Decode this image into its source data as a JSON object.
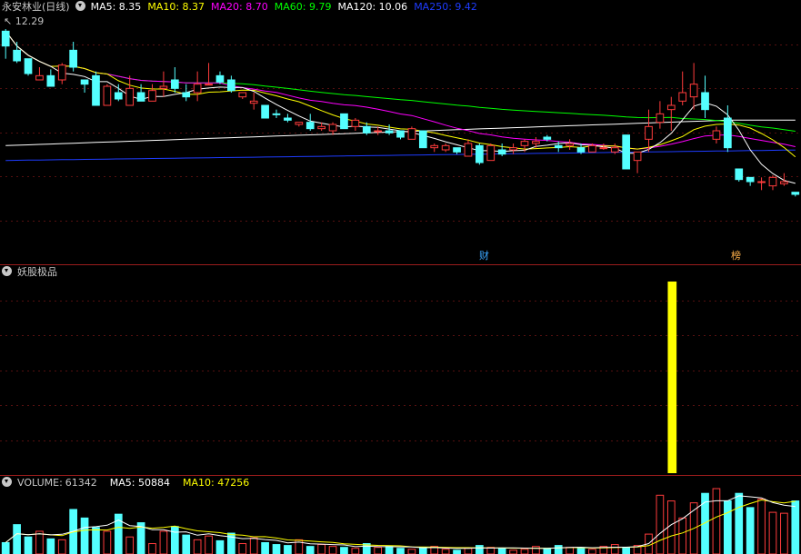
{
  "main": {
    "name": "永安林业(日线)",
    "ma": [
      {
        "label": "MA5:",
        "value": "8.35",
        "color": "#ffffff"
      },
      {
        "label": "MA10:",
        "value": "8.37",
        "color": "#ffff00"
      },
      {
        "label": "MA20:",
        "value": "8.70",
        "color": "#ff00ff"
      },
      {
        "label": "MA60:",
        "value": "9.79",
        "color": "#00ff00"
      },
      {
        "label": "MA120:",
        "value": "10.06",
        "color": "#ffffff"
      },
      {
        "label": "MA250:",
        "value": "9.42",
        "color": "#1e3cff"
      }
    ],
    "high_label": "12.29",
    "tags": [
      {
        "text": "财"
      },
      {
        "text": "榜"
      }
    ]
  },
  "indicator": {
    "name": "妖股极品",
    "bar_color": "#ffff00"
  },
  "volume": {
    "label": "VOLUME:",
    "value": "61342",
    "ma": [
      {
        "label": "MA5:",
        "value": "50884",
        "color": "#ffffff"
      },
      {
        "label": "MA10:",
        "value": "47256",
        "color": "#ffff00"
      }
    ]
  },
  "colors": {
    "up": "#ff3c3c",
    "down": "#54ffff",
    "border": "#9b1c1c",
    "grid": "#551010"
  },
  "chart_data": {
    "type": "candlestick",
    "price_range": [
      7.2,
      12.6
    ],
    "candles": [
      [
        11.9,
        12.3,
        11.6,
        12.25,
        1
      ],
      [
        11.8,
        12.0,
        11.5,
        11.55,
        1
      ],
      [
        11.6,
        11.6,
        11.2,
        11.25,
        1
      ],
      [
        11.2,
        11.4,
        11.1,
        11.1,
        0
      ],
      [
        11.2,
        11.35,
        10.95,
        10.95,
        1
      ],
      [
        11.1,
        11.5,
        11.0,
        11.45,
        0
      ],
      [
        11.8,
        12.0,
        11.3,
        11.4,
        1
      ],
      [
        11.1,
        11.1,
        10.8,
        11.0,
        1
      ],
      [
        11.2,
        11.3,
        10.5,
        10.5,
        1
      ],
      [
        10.5,
        11.0,
        10.5,
        10.95,
        0
      ],
      [
        10.8,
        11.0,
        10.6,
        10.65,
        1
      ],
      [
        10.9,
        11.2,
        10.5,
        10.5,
        0
      ],
      [
        10.8,
        11.0,
        10.6,
        10.6,
        1
      ],
      [
        10.6,
        11.0,
        10.6,
        10.85,
        0
      ],
      [
        10.9,
        11.3,
        10.7,
        10.95,
        0
      ],
      [
        11.1,
        11.4,
        10.8,
        10.9,
        1
      ],
      [
        10.8,
        11.0,
        10.6,
        10.7,
        1
      ],
      [
        10.8,
        11.3,
        10.6,
        11.0,
        0
      ],
      [
        11.0,
        11.5,
        11.0,
        11.0,
        0
      ],
      [
        11.2,
        11.3,
        11.0,
        11.05,
        1
      ],
      [
        11.1,
        11.2,
        10.8,
        10.85,
        1
      ],
      [
        10.8,
        10.8,
        10.65,
        10.7,
        0
      ],
      [
        10.6,
        10.8,
        10.4,
        10.55,
        0
      ],
      [
        10.5,
        10.5,
        10.2,
        10.2,
        1
      ],
      [
        10.3,
        10.4,
        10.2,
        10.3,
        1
      ],
      [
        10.2,
        10.3,
        10.1,
        10.15,
        1
      ],
      [
        10.1,
        10.1,
        10.0,
        10.05,
        0
      ],
      [
        10.1,
        10.3,
        9.9,
        9.95,
        1
      ],
      [
        10.0,
        10.1,
        9.9,
        9.95,
        0
      ],
      [
        9.9,
        10.1,
        9.8,
        10.05,
        0
      ],
      [
        10.3,
        10.3,
        9.95,
        9.95,
        1
      ],
      [
        10.0,
        10.2,
        9.9,
        10.15,
        0
      ],
      [
        10.0,
        10.1,
        9.8,
        9.85,
        1
      ],
      [
        9.9,
        10.0,
        9.8,
        9.9,
        0
      ],
      [
        9.9,
        10.05,
        9.8,
        9.85,
        1
      ],
      [
        9.9,
        9.9,
        9.7,
        9.75,
        1
      ],
      [
        9.7,
        10.0,
        9.7,
        9.95,
        0
      ],
      [
        9.9,
        9.9,
        9.5,
        9.5,
        1
      ],
      [
        9.5,
        9.6,
        9.4,
        9.55,
        0
      ],
      [
        9.55,
        9.6,
        9.4,
        9.45,
        0
      ],
      [
        9.5,
        9.5,
        9.35,
        9.4,
        1
      ],
      [
        9.3,
        9.7,
        9.3,
        9.6,
        0
      ],
      [
        9.55,
        9.6,
        9.1,
        9.15,
        1
      ],
      [
        9.2,
        9.6,
        9.2,
        9.55,
        0
      ],
      [
        9.45,
        9.6,
        9.3,
        9.35,
        1
      ],
      [
        9.45,
        9.6,
        9.35,
        9.5,
        0
      ],
      [
        9.55,
        9.7,
        9.4,
        9.65,
        0
      ],
      [
        9.65,
        9.75,
        9.5,
        9.6,
        0
      ],
      [
        9.75,
        9.8,
        9.65,
        9.7,
        1
      ],
      [
        9.5,
        9.65,
        9.4,
        9.55,
        1
      ],
      [
        9.55,
        9.7,
        9.45,
        9.6,
        0
      ],
      [
        9.5,
        9.6,
        9.35,
        9.4,
        1
      ],
      [
        9.4,
        9.6,
        9.4,
        9.55,
        0
      ],
      [
        9.5,
        9.6,
        9.45,
        9.5,
        0
      ],
      [
        9.5,
        9.6,
        9.35,
        9.4,
        0
      ],
      [
        9.8,
        9.8,
        9.0,
        9.0,
        1
      ],
      [
        9.2,
        9.4,
        8.9,
        9.4,
        0
      ],
      [
        9.7,
        10.4,
        9.4,
        10.0,
        0
      ],
      [
        10.1,
        10.6,
        9.95,
        10.3,
        0
      ],
      [
        10.4,
        10.7,
        9.9,
        10.5,
        0
      ],
      [
        10.8,
        11.3,
        10.5,
        10.6,
        0
      ],
      [
        10.7,
        11.5,
        10.4,
        11.0,
        0
      ],
      [
        10.8,
        11.2,
        10.2,
        10.4,
        1
      ],
      [
        9.7,
        10.0,
        9.6,
        9.9,
        0
      ],
      [
        10.2,
        10.5,
        9.4,
        9.5,
        1
      ],
      [
        9.0,
        9.0,
        8.7,
        8.75,
        1
      ],
      [
        8.8,
        8.8,
        8.6,
        8.7,
        1
      ],
      [
        8.7,
        8.8,
        8.5,
        8.7,
        0
      ],
      [
        8.6,
        8.85,
        8.5,
        8.8,
        0
      ],
      [
        8.65,
        8.9,
        8.6,
        8.7,
        0
      ],
      [
        8.45,
        8.45,
        8.35,
        8.4,
        1
      ]
    ],
    "volume": [
      120,
      310,
      180,
      240,
      160,
      150,
      470,
      380,
      280,
      240,
      420,
      180,
      330,
      110,
      240,
      290,
      200,
      150,
      190,
      140,
      220,
      110,
      170,
      120,
      100,
      90,
      150,
      80,
      100,
      80,
      70,
      60,
      110,
      70,
      80,
      60,
      50,
      70,
      80,
      50,
      40,
      60,
      90,
      70,
      60,
      40,
      50,
      80,
      60,
      90,
      70,
      60,
      50,
      80,
      100,
      70,
      90,
      210,
      620,
      560,
      380,
      540,
      640,
      690,
      560,
      640,
      490,
      580,
      440,
      430,
      560
    ],
    "indicator_bar_index": 59,
    "indicator_value": 1
  }
}
